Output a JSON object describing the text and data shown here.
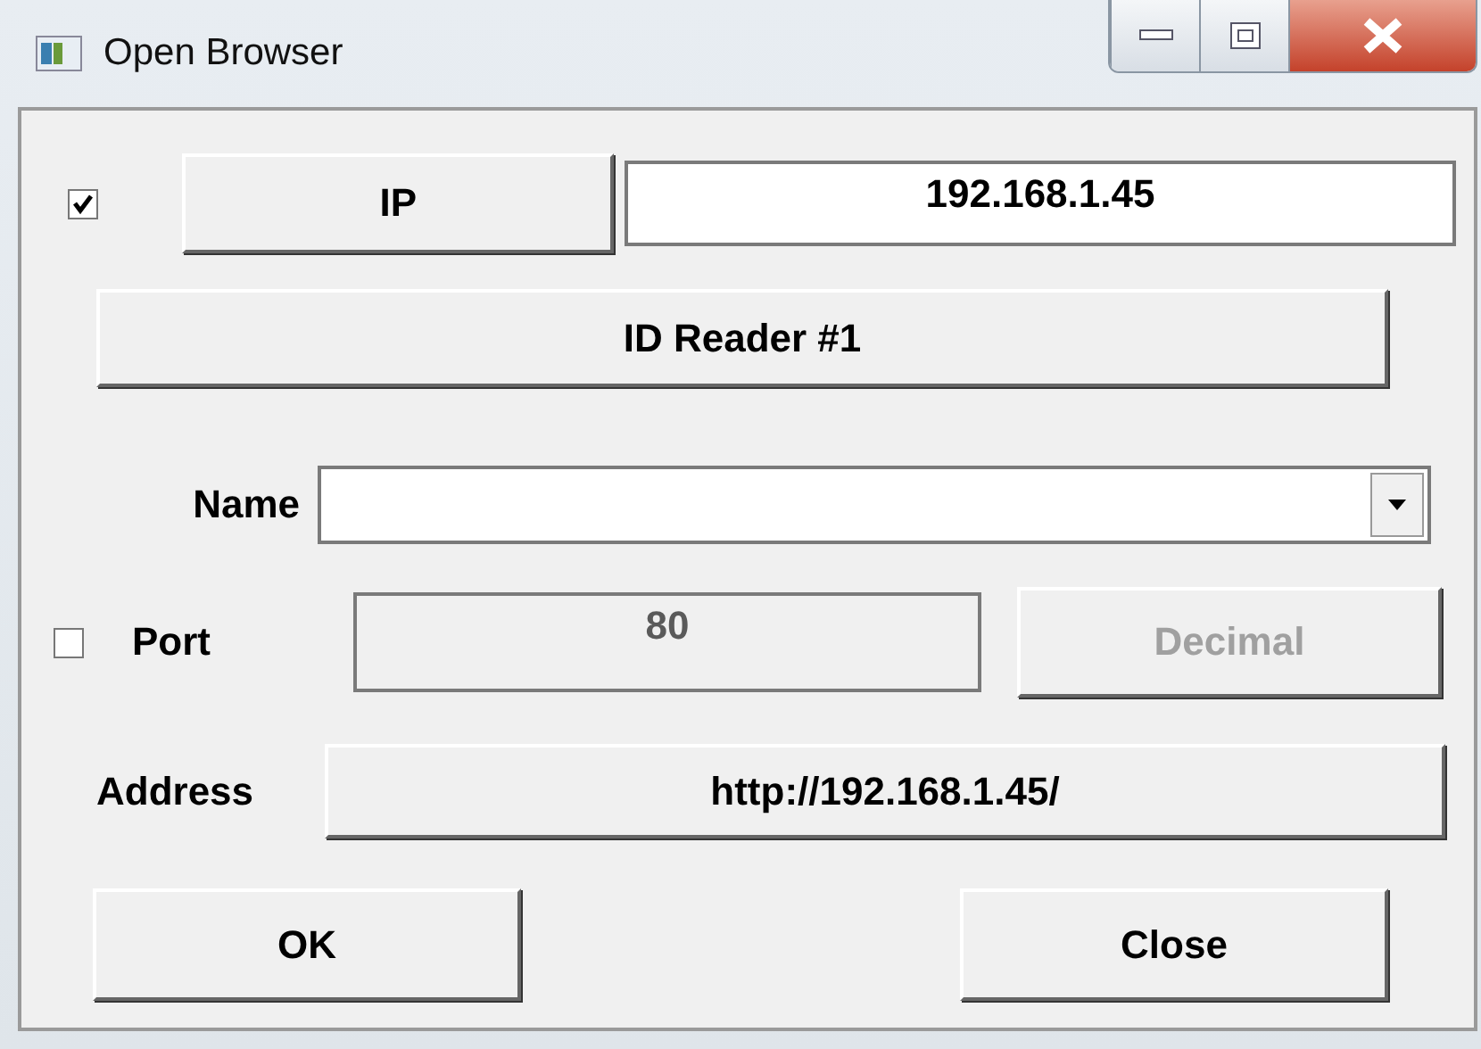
{
  "window": {
    "title": "Open Browser"
  },
  "ip": {
    "checked": true,
    "button": "IP",
    "value": "192.168.1.45"
  },
  "reader_button": "ID Reader #1",
  "name": {
    "label": "Name"
  },
  "port": {
    "checked": false,
    "label": "Port",
    "value": "80",
    "disabled": true,
    "format_button": "Decimal",
    "format_disabled": true
  },
  "address": {
    "label": "Address",
    "value": "http://192.168.1.45/"
  },
  "buttons": [
    {
      "label": "OK"
    },
    {
      "label": "Close"
    }
  ]
}
